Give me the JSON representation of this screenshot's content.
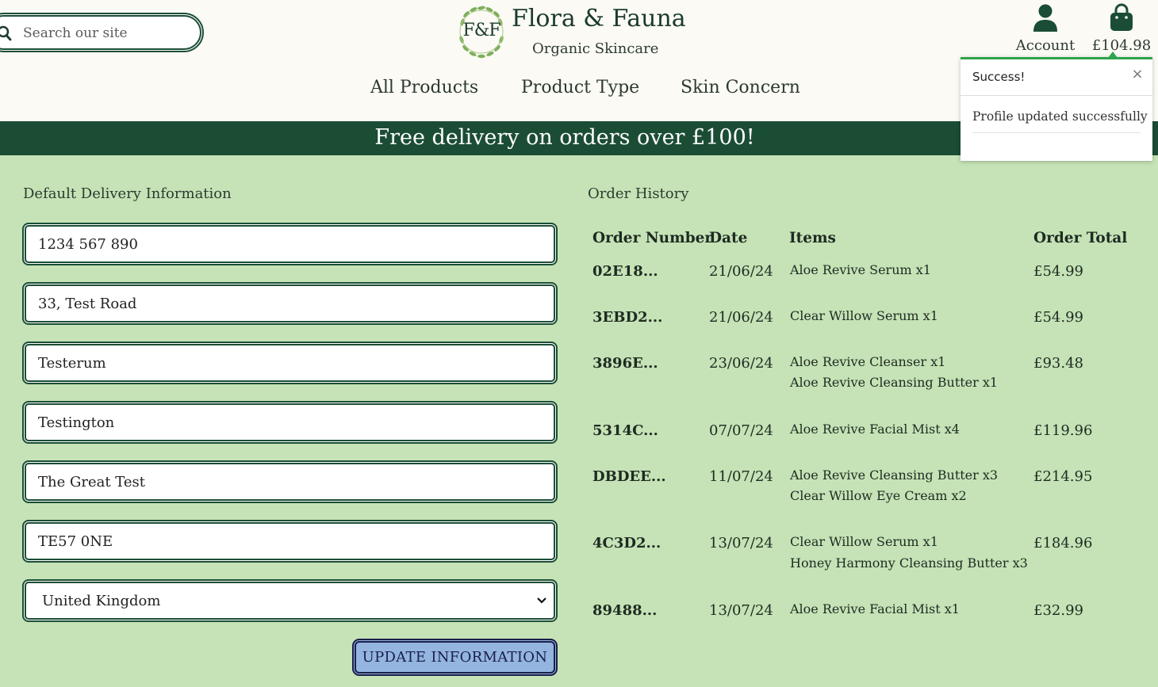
{
  "header": {
    "search_placeholder": "Search our site",
    "logo_text": "F&F",
    "brand_name": "Flora & Fauna",
    "brand_tagline": "Organic Skincare",
    "account_label": "Account",
    "bag_total": "£104.98",
    "nav": [
      "All Products",
      "Product Type",
      "Skin Concern"
    ]
  },
  "banner": "Free delivery on orders over £100!",
  "toast": {
    "title": "Success!",
    "close": "×",
    "message": "Profile updated successfully"
  },
  "delivery": {
    "title": "Default Delivery Information",
    "phone": "1234 567 890",
    "street": "33, Test Road",
    "town": "Testerum",
    "city": "Testington",
    "county": "The Great Test",
    "postcode": "TE57 0NE",
    "country": "United Kingdom",
    "submit_label": "UPDATE INFORMATION"
  },
  "orders": {
    "title": "Order History",
    "headers": [
      "Order Number",
      "Date",
      "Items",
      "Order Total"
    ],
    "rows": [
      {
        "number": "02E18...",
        "date": "21/06/24",
        "items": [
          "Aloe Revive Serum x1"
        ],
        "total": "£54.99"
      },
      {
        "number": "3EBD2...",
        "date": "21/06/24",
        "items": [
          "Clear Willow Serum x1"
        ],
        "total": "£54.99"
      },
      {
        "number": "3896E...",
        "date": "23/06/24",
        "items": [
          "Aloe Revive Cleanser x1",
          "Aloe Revive Cleansing Butter x1"
        ],
        "total": "£93.48"
      },
      {
        "number": "5314C...",
        "date": "07/07/24",
        "items": [
          "Aloe Revive Facial Mist x4"
        ],
        "total": "£119.96"
      },
      {
        "number": "DBDEE...",
        "date": "11/07/24",
        "items": [
          "Aloe Revive Cleansing Butter x3",
          "Clear Willow Eye Cream x2"
        ],
        "total": "£214.95"
      },
      {
        "number": "4C3D2...",
        "date": "13/07/24",
        "items": [
          "Clear Willow Serum x1",
          "Honey Harmony Cleansing Butter x3"
        ],
        "total": "£184.96"
      },
      {
        "number": "89488...",
        "date": "13/07/24",
        "items": [
          "Aloe Revive Facial Mist x1"
        ],
        "total": "£32.99"
      }
    ]
  },
  "colors": {
    "brand_green": "#1b4d35",
    "page_background": "#c5e3b6",
    "button_blue": "#93b5e0",
    "toast_accent": "#2fa34e"
  }
}
